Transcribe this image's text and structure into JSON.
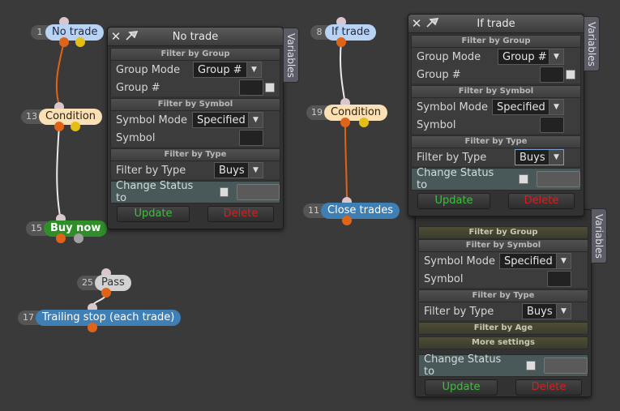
{
  "nodes": {
    "n1": {
      "num": "1",
      "label": "No trade"
    },
    "n13": {
      "num": "13",
      "label": "Condition"
    },
    "n15": {
      "num": "15",
      "label": "Buy now"
    },
    "n25": {
      "num": "25",
      "label": "Pass"
    },
    "n17": {
      "num": "17",
      "label": "Trailing stop (each trade)"
    },
    "n8": {
      "num": "8",
      "label": "If trade"
    },
    "n19": {
      "num": "19",
      "label": "Condition"
    },
    "n11": {
      "num": "11",
      "label": "Close trades"
    }
  },
  "panel_left": {
    "title": "No trade",
    "variables_tab": "Variables",
    "filter_by_group": "Filter by Group",
    "group_mode_label": "Group Mode",
    "group_mode_value": "Group #",
    "group_num_label": "Group #",
    "filter_by_symbol": "Filter by Symbol",
    "symbol_mode_label": "Symbol Mode",
    "symbol_mode_value": "Specified",
    "symbol_label": "Symbol",
    "filter_by_type": "Filter by Type",
    "filter_type_label": "Filter by Type",
    "filter_type_value": "Buys",
    "change_status_label": "Change Status to",
    "update": "Update",
    "delete": "Delete"
  },
  "panel_right": {
    "title": "If trade",
    "variables_tab": "Variables",
    "filter_by_group": "Filter by Group",
    "group_mode_label": "Group Mode",
    "group_mode_value": "Group #",
    "group_num_label": "Group #",
    "filter_by_symbol": "Filter by Symbol",
    "symbol_mode_label": "Symbol Mode",
    "symbol_mode_value": "Specified",
    "symbol_label": "Symbol",
    "filter_by_type": "Filter by Type",
    "filter_type_label": "Filter by Type",
    "filter_type_value": "Buys",
    "change_status_label": "Change Status to",
    "update": "Update",
    "delete": "Delete"
  },
  "panel_lower": {
    "variables_tab": "Variables",
    "filter_by_group": "Filter by Group",
    "filter_by_symbol": "Filter by Symbol",
    "symbol_mode_label": "Symbol Mode",
    "symbol_mode_value": "Specified",
    "symbol_label": "Symbol",
    "filter_by_type": "Filter by Type",
    "filter_type_label": "Filter by Type",
    "filter_type_value": "Buys",
    "filter_by_age": "Filter by Age",
    "more_settings": "More settings",
    "change_status_label": "Change Status to",
    "update": "Update",
    "delete": "Delete"
  },
  "colors": {
    "link_orange": "#e06417",
    "link_white": "#f0e8e8",
    "update_text": "#3fbf3f",
    "delete_text": "#d81e1e"
  }
}
